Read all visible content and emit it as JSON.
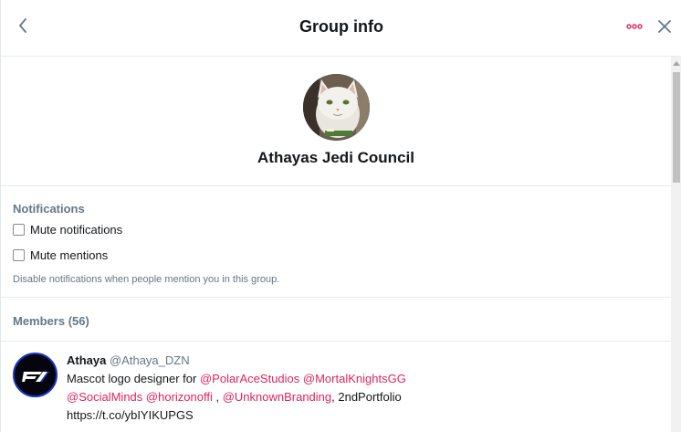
{
  "header": {
    "title": "Group info",
    "back_icon": "chevron-left-icon",
    "more_icon": "more-horizontal-icon",
    "close_icon": "close-icon",
    "accent_color": "#e0245e"
  },
  "group": {
    "name": "Athayas Jedi Council",
    "avatar_icon": "cat-avatar-image"
  },
  "notifications": {
    "title": "Notifications",
    "options": [
      {
        "label": "Mute notifications",
        "checked": false
      },
      {
        "label": "Mute mentions",
        "checked": false
      }
    ],
    "hint": "Disable notifications when people mention you in this group."
  },
  "members": {
    "title": "Members (56)",
    "list": [
      {
        "name": "Athaya",
        "handle": "@Athaya_DZN",
        "bio_prefix": "Mascot logo designer for ",
        "mention1": "@PolarAceStudios",
        "mention2": "@MortalKnightsGG",
        "mention3": "@SocialMinds",
        "mention4": "@horizonoffi",
        "sep": " , ",
        "mention5": "@UnknownBranding",
        "bio_suffix": ", 2ndPortfolio",
        "url": "https://t.co/ybIYIKUPGS"
      }
    ]
  }
}
